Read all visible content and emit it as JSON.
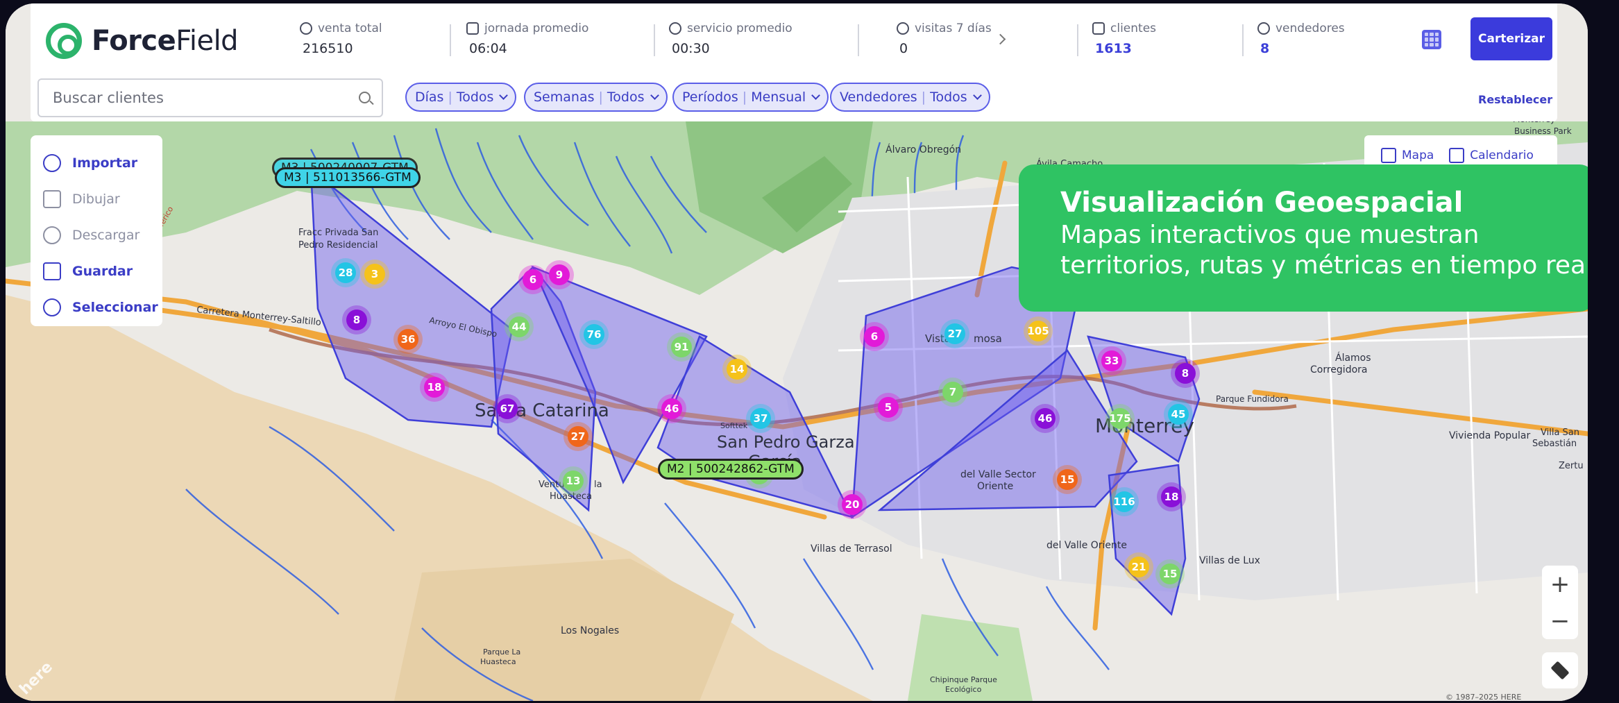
{
  "brand": {
    "name_bold": "Force",
    "name_light": "Field"
  },
  "metrics": [
    {
      "label": "venta total",
      "value": "216510",
      "icon": "dollar-icon"
    },
    {
      "label": "jornada promedio",
      "value": "06:04",
      "icon": "briefcase-icon"
    },
    {
      "label": "servicio promedio",
      "value": "00:30",
      "icon": "clock-icon"
    },
    {
      "label": "visitas 7 días",
      "value": "0",
      "icon": "location-pin-icon"
    },
    {
      "label": "clientes",
      "value": "1613",
      "icon": "store-icon"
    },
    {
      "label": "vendedores",
      "value": "8",
      "icon": "users-icon"
    }
  ],
  "actions": {
    "primary": "Carterizar",
    "reset": "Restablecer"
  },
  "search": {
    "placeholder": "Buscar clientes"
  },
  "filters": [
    {
      "name": "Días",
      "value": "Todos"
    },
    {
      "name": "Semanas",
      "value": "Todos"
    },
    {
      "name": "Períodos",
      "value": "Mensual"
    },
    {
      "name": "Vendedores",
      "value": "Todos"
    }
  ],
  "view_toggle": {
    "map": "Mapa",
    "calendar": "Calendario"
  },
  "tools": [
    {
      "label": "Importar",
      "enabled": true,
      "icon": "upload-cloud-icon"
    },
    {
      "label": "Dibujar",
      "enabled": false,
      "icon": "draw-polygon-icon"
    },
    {
      "label": "Descargar",
      "enabled": false,
      "icon": "download-cloud-icon"
    },
    {
      "label": "Guardar",
      "enabled": true,
      "icon": "folder-icon"
    },
    {
      "label": "Seleccionar",
      "enabled": true,
      "icon": "select-pointer-icon"
    }
  ],
  "route_badges": [
    {
      "text": "M3 | 511013566-GTM",
      "ghost_text": "M3 | 500240007-GTM",
      "color": "#3fd4e8"
    },
    {
      "text": "M2 | 500242862-GTM",
      "color": "#8fe06a"
    }
  ],
  "callout": {
    "title": "Visualización Geoespacial",
    "body": "Mapas interactivos que muestran territorios, rutas y métricas en tiempo real"
  },
  "map": {
    "labels": {
      "santa_catarina": "Santa Catarina",
      "san_pedro": "San Pedro Garza",
      "san_pedro_2": "García",
      "monterrey": "Monterrey",
      "alvaro": "Álvaro Obregón",
      "fracc": "Fracc Privada San",
      "fracc2": "Pedro Residencial",
      "carretera": "Carretera Monterrey-Saltillo",
      "villas_terrasol": "Villas de Terrasol",
      "del_valle_sector": "del Valle Sector",
      "del_valle_sector2": "Oriente",
      "del_valle_oriente": "del Valle Oriente",
      "villas_lux": "Villas de Lux",
      "alamos": "Álamos",
      "corregidora": "Corregidora",
      "vivienda": "Vivienda Popular",
      "villa_san": "Villa San",
      "sebastian": "Sebastián",
      "los_nogales": "Los Nogales",
      "parque": "Parque La",
      "huasteca": "Huasteca",
      "chipinque": "Chipinque Parque",
      "ecologico": "Ecológico",
      "fundidora": "Parque Fundidora",
      "vista": "Vista",
      "hermosa": "mosa",
      "ventura": "Ventu",
      "la": "la",
      "huasteca2": "Huasteca",
      "zertu": "Zertu",
      "business": "Business Park",
      "monterrey_bp": "Monterrey",
      "avila": "Ávila Camacho",
      "periferico": "Periférico",
      "here": "here",
      "copyright": "© 1987–2025 HERE",
      "softtek": "Softtek",
      "arroyo": "Arroyo El Obispo"
    },
    "clusters": [
      {
        "n": "28",
        "c": "#22c5e5"
      },
      {
        "n": "3",
        "c": "#f5c21a"
      },
      {
        "n": "8",
        "c": "#8a10d8"
      },
      {
        "n": "36",
        "c": "#f0661a"
      },
      {
        "n": "18",
        "c": "#e21ad8"
      },
      {
        "n": "6",
        "c": "#e21ad8"
      },
      {
        "n": "9",
        "c": "#e21ad8"
      },
      {
        "n": "44",
        "c": "#7dd66a"
      },
      {
        "n": "76",
        "c": "#22c5e5"
      },
      {
        "n": "91",
        "c": "#7dd66a"
      },
      {
        "n": "67",
        "c": "#8a10d8"
      },
      {
        "n": "27",
        "c": "#f0661a"
      },
      {
        "n": "13",
        "c": "#7dd66a"
      },
      {
        "n": "14",
        "c": "#f5c21a"
      },
      {
        "n": "46",
        "c": "#e21ad8"
      },
      {
        "n": "37",
        "c": "#22c5e5"
      },
      {
        "n": "15",
        "c": "#7dd66a"
      },
      {
        "n": "20",
        "c": "#e21ad8"
      },
      {
        "n": "6",
        "c": "#e21ad8"
      },
      {
        "n": "27",
        "c": "#22c5e5"
      },
      {
        "n": "105",
        "c": "#f5c21a"
      },
      {
        "n": "5",
        "c": "#e21ad8"
      },
      {
        "n": "7",
        "c": "#7dd66a"
      },
      {
        "n": "46",
        "c": "#8a10d8"
      },
      {
        "n": "33",
        "c": "#e21ad8"
      },
      {
        "n": "8",
        "c": "#8a10d8"
      },
      {
        "n": "175",
        "c": "#7dd66a"
      },
      {
        "n": "45",
        "c": "#22c5e5"
      },
      {
        "n": "15",
        "c": "#f0661a"
      },
      {
        "n": "116",
        "c": "#22c5e5"
      },
      {
        "n": "18",
        "c": "#8a10d8"
      },
      {
        "n": "21",
        "c": "#f5c21a"
      },
      {
        "n": "15",
        "c": "#7dd66a"
      }
    ]
  },
  "zoom": {
    "in": "+",
    "out": "−"
  }
}
